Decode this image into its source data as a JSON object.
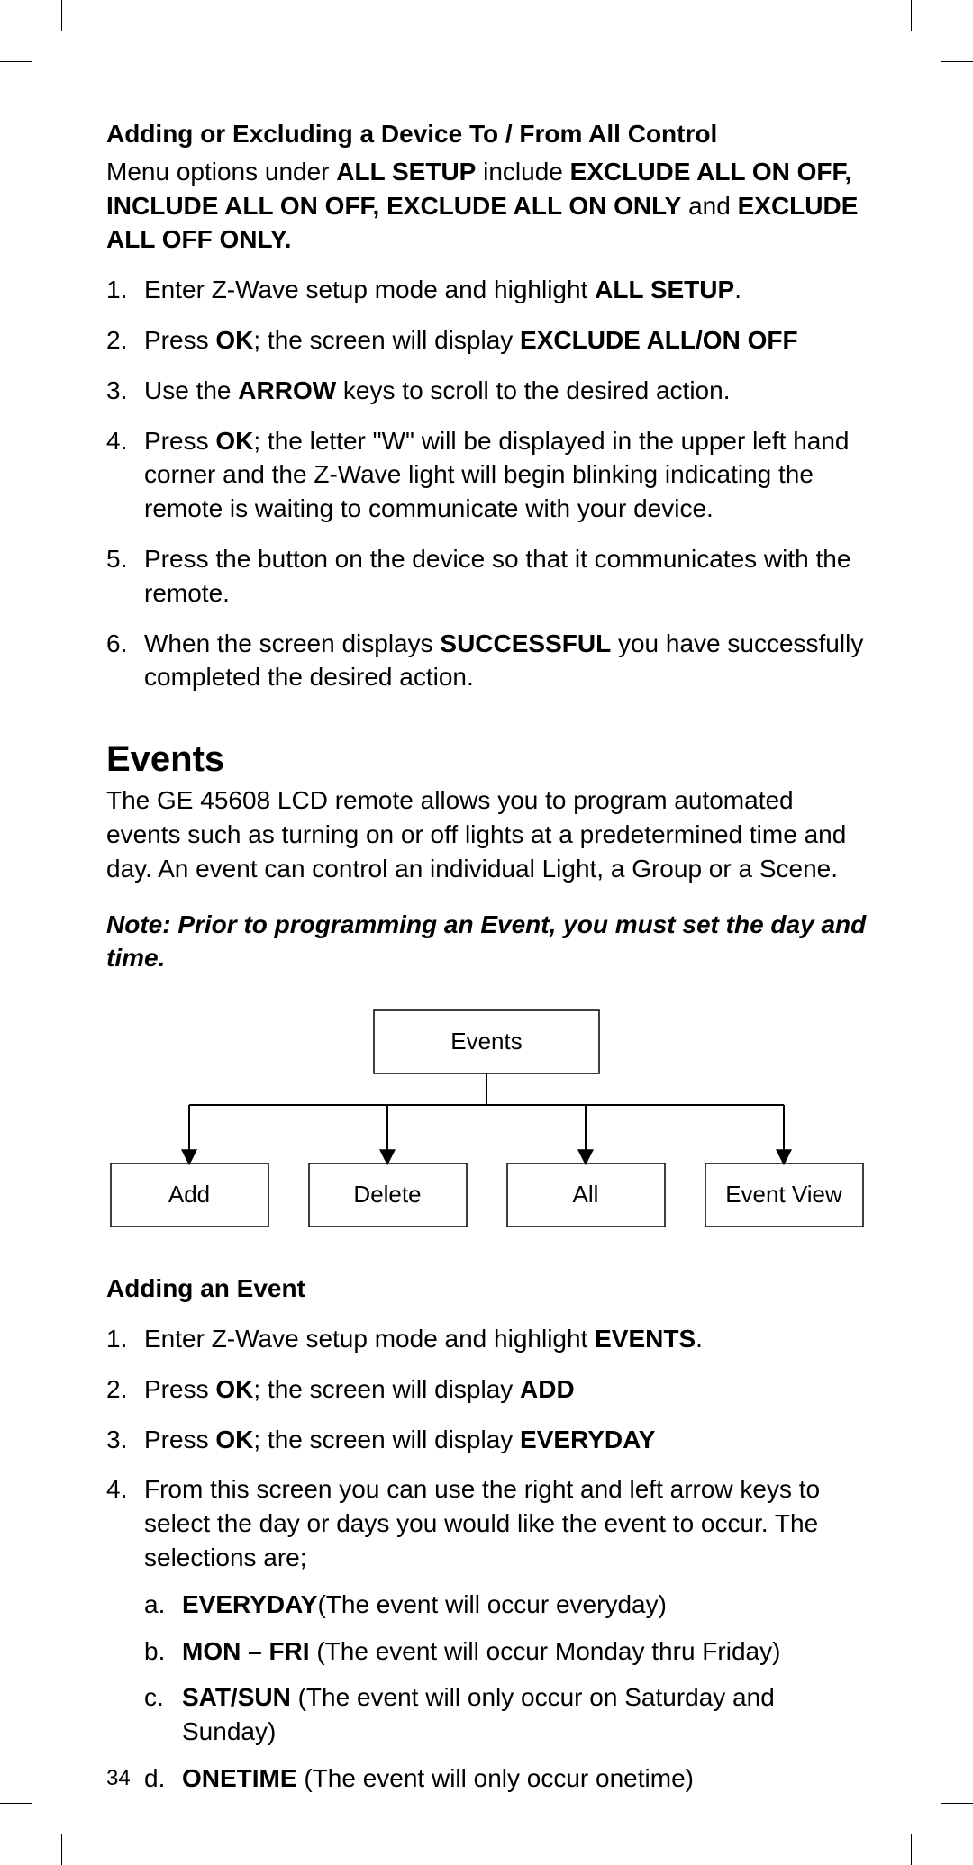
{
  "page_number": "34",
  "section1": {
    "heading": "Adding or Excluding a Device To / From All Control",
    "intro_pre": "Menu options under ",
    "intro_bold1": "ALL SETUP",
    "intro_mid1": " include ",
    "intro_bold2": "EXCLUDE ALL ON OFF, INCLUDE ALL ON OFF, EXCLUDE ALL ON ONLY",
    "intro_mid2": " and ",
    "intro_bold3": "EXCLUDE ALL OFF ONLY.",
    "steps": {
      "s1_pre": "Enter Z-Wave setup mode and highlight ",
      "s1_bold": "ALL SETUP",
      "s1_post": ".",
      "s2_pre": "Press ",
      "s2_bold1": "OK",
      "s2_mid": "; the screen will display ",
      "s2_bold2": "EXCLUDE ALL/ON OFF",
      "s3_pre": "Use the ",
      "s3_bold": "ARROW",
      "s3_post": " keys to scroll to the desired action.",
      "s4_pre": "Press ",
      "s4_bold": "OK",
      "s4_post": "; the letter \"W\" will be displayed in the upper left hand corner and the Z-Wave light will begin blinking indicating the remote is waiting to communicate with your device.",
      "s5": "Press the button on the device so that it communicates with the remote.",
      "s6_pre": "When the screen displays ",
      "s6_bold": "SUCCESSFUL",
      "s6_post": " you have successfully completed the desired action."
    }
  },
  "section2": {
    "heading": "Events",
    "intro": "The GE 45608 LCD remote allows you to program automated events such as turning on or off lights at a predetermined time and day. An event can control an individual Light, a Group or a Scene.",
    "note": "Note: Prior to programming an Event, you must set the day and time."
  },
  "chart_data": {
    "type": "hierarchy",
    "root": "Events",
    "children": [
      "Add",
      "Delete",
      "All",
      "Event View"
    ]
  },
  "section3": {
    "heading": "Adding an Event",
    "steps": {
      "s1_pre": "Enter Z-Wave setup mode and highlight ",
      "s1_bold": "EVENTS",
      "s1_post": ".",
      "s2_pre": "Press ",
      "s2_bold1": "OK",
      "s2_mid": "; the screen will display ",
      "s2_bold2": "ADD",
      "s3_pre": "Press ",
      "s3_bold1": "OK",
      "s3_mid": "; the screen will display ",
      "s3_bold2": "EVERYDAY",
      "s4": "From this screen you can use the right and left arrow keys to select the day or days you would like the event to occur. The selections are;",
      "a_bold": "EVERYDAY",
      "a_post": "(The event will occur everyday)",
      "b_bold": "MON – FRI",
      "b_post": " (The event will occur Monday thru Friday)",
      "c_bold": "SAT/SUN",
      "c_post": " (The event will only occur on Saturday and Sunday)",
      "d_bold": "ONETIME",
      "d_post": " (The event will only occur onetime)"
    }
  },
  "nums": {
    "n1": "1.",
    "n2": "2.",
    "n3": "3.",
    "n4": "4.",
    "n5": "5.",
    "n6": "6.",
    "a": "a.",
    "b": "b.",
    "c": "c.",
    "d": "d."
  }
}
